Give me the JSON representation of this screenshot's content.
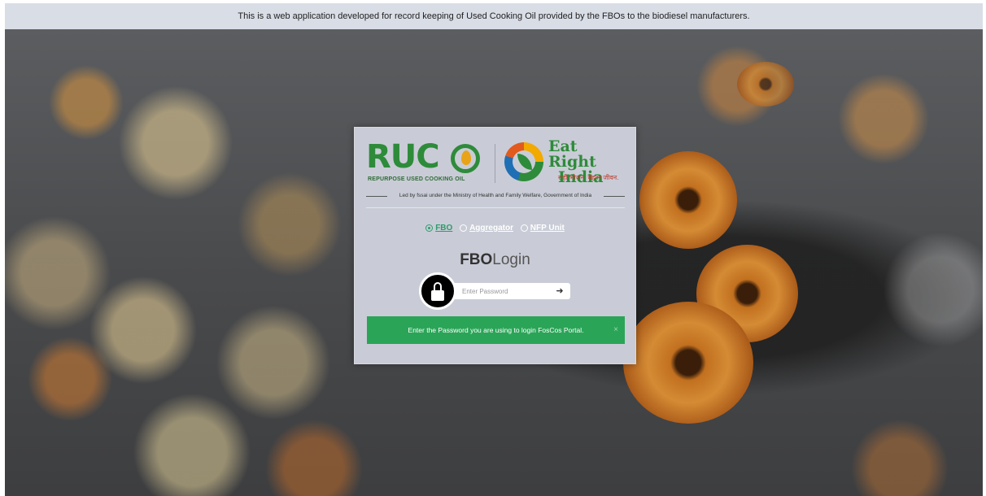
{
  "banner": {
    "text": "This is a web application developed for record keeping of Used Cooking Oil provided by the FBOs to the biodiesel manufacturers."
  },
  "logos": {
    "ruco_word": "RUC",
    "ruco_subtitle": "REPURPOSE USED COOKING OIL",
    "eat_right_line1": "Eat Right",
    "eat_right_line2": "India",
    "eat_right_tagline": "सही भोजन. बेहतर जीवन.",
    "led_by": "Led by fssai under the Ministry of Health and Family Welfare, Government of India"
  },
  "roles": {
    "fbo": "FBO",
    "aggregator": "Aggregator",
    "nfp_unit": "NFP Unit",
    "selected": "FBO"
  },
  "login": {
    "title_bold": "FBO",
    "title_light": "Login",
    "password_placeholder": "Enter Password",
    "submit_icon": "arrow-right-icon",
    "lock_icon": "lock-icon"
  },
  "alert": {
    "message": "Enter the Password you are using to login FosCos Portal.",
    "close": "×"
  },
  "colors": {
    "brand_green": "#2e8b3a",
    "alert_green": "#2aa557",
    "selected_radio": "#2a9d6b",
    "banner_bg": "#d9dde6",
    "card_bg": "#c9ccd6"
  }
}
